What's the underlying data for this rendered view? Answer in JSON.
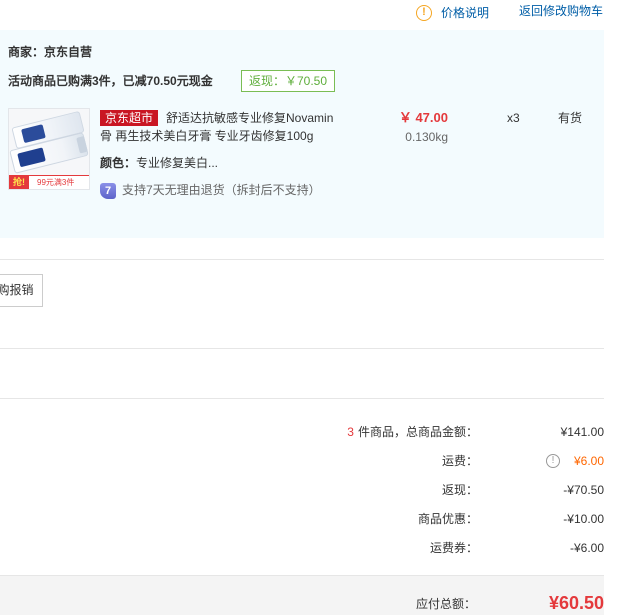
{
  "top_bar": {
    "price_note_label": "价格说明",
    "back_to_cart_label": "返回修改购物车"
  },
  "order_group": {
    "seller_label": "商家：",
    "seller_name": "京东自营",
    "promo_text": "活动商品已购满3件，已减70.50元现金",
    "cashback_tag": "返现：￥70.50",
    "items": [
      {
        "image_grab_tag": "抢!",
        "image_promo_text": "99元满3件",
        "channel_badge": "京东超市",
        "title": "舒适达抗敏感专业修复Novamin骨 再生技术美白牙膏 专业牙齿修复100g",
        "price": "￥ 47.00",
        "weight": "0.130kg",
        "quantity": "x3",
        "stock_status": "有货",
        "attr_label": "颜色：",
        "attr_value": "专业修复美白...",
        "return_badge_text": "7",
        "return_policy": "支持7天无理由退货（拆封后不支持）"
      }
    ]
  },
  "invoice_button_label": "购报销",
  "summary": {
    "item_count": "3",
    "subtotal_label": "件商品，总商品金额：",
    "subtotal_value": "¥141.00",
    "freight_label": "运费：",
    "freight_value": "¥6.00",
    "cashback_label": "返现：",
    "cashback_value": "-¥70.50",
    "discount_label": "商品优惠：",
    "discount_value": "-¥10.00",
    "freight_coupon_label": "运费券：",
    "freight_coupon_value": "-¥6.00"
  },
  "payable": {
    "label": "应付总额：",
    "value": "¥60.50"
  },
  "icons": {
    "price_note": "info-circle-icon",
    "freight_info": "info-circle-icon",
    "return_policy": "seven-day-return-icon"
  },
  "colors": {
    "accent_red": "#e4393c",
    "channel_badge_red": "#c91623",
    "freight_orange": "#ff6600",
    "cashback_green": "#7abd54",
    "link_blue": "#005ea7",
    "group_panel_bg": "#f3fbfe",
    "footer_bg": "#f4f4f4"
  }
}
